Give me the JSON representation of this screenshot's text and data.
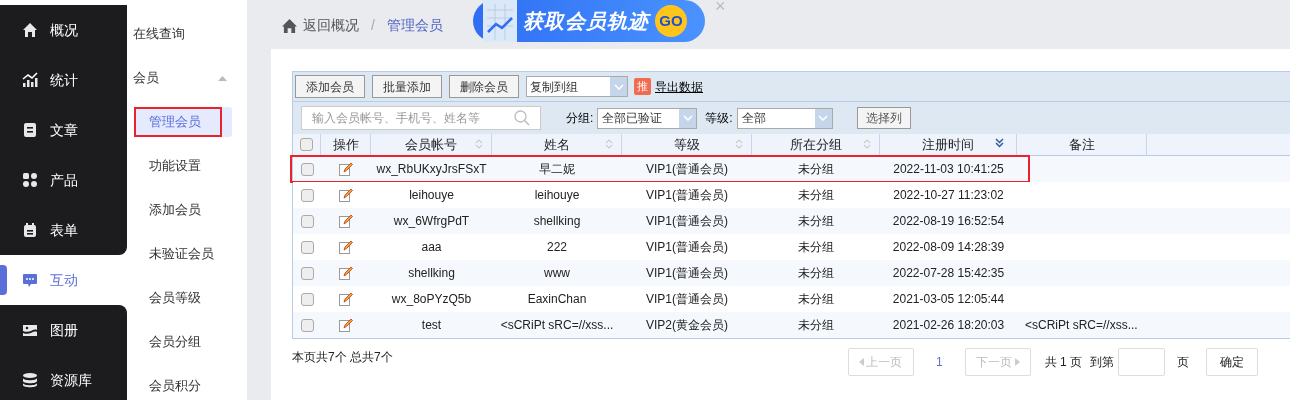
{
  "main_nav": [
    {
      "label": "概况",
      "kind": "home",
      "selected": false
    },
    {
      "label": "统计",
      "kind": "chart",
      "selected": false
    },
    {
      "label": "文章",
      "kind": "doc",
      "selected": false
    },
    {
      "label": "产品",
      "kind": "grid",
      "selected": false
    },
    {
      "label": "表单",
      "kind": "form",
      "selected": false
    },
    {
      "label": "互动",
      "kind": "chat",
      "selected": true
    },
    {
      "label": "图册",
      "kind": "album",
      "selected": false
    },
    {
      "label": "资源库",
      "kind": "db",
      "selected": false
    }
  ],
  "sub_nav": [
    {
      "label": "在线查询",
      "selected": false,
      "annotated": false
    },
    {
      "label": "会员",
      "expanded": true,
      "children": [
        {
          "label": "管理会员",
          "selected": true,
          "annotated": true
        },
        {
          "label": "功能设置",
          "selected": false,
          "annotated": false
        },
        {
          "label": "添加会员",
          "selected": false,
          "annotated": false
        },
        {
          "label": "未验证会员",
          "selected": false,
          "annotated": false
        },
        {
          "label": "会员等级",
          "selected": false,
          "annotated": false
        },
        {
          "label": "会员分组",
          "selected": false,
          "annotated": false
        },
        {
          "label": "会员积分",
          "selected": false,
          "annotated": false
        }
      ]
    }
  ],
  "breadcrumb": {
    "back": "返回概况",
    "separator": "/",
    "current": "管理会员"
  },
  "banner": {
    "text": "获取会员轨迹",
    "button": "GO",
    "close": "×"
  },
  "toolbar": {
    "buttons": [
      "添加会员",
      "批量添加",
      "删除会员"
    ],
    "copy_select": "复制到组",
    "export_badge": "推",
    "export_link": "导出数据"
  },
  "filters": {
    "search_placeholder": "输入会员帐号、手机号、姓名等",
    "group_label": "分组:",
    "group_value": "全部已验证",
    "level_label": "等级:",
    "level_value": "全部",
    "columns_button": "选择列"
  },
  "table": {
    "columns": [
      {
        "kind": "checkbox",
        "checked": false
      },
      {
        "label": "操作",
        "kind": "plain"
      },
      {
        "label": "会员帐号",
        "kind": "sortable"
      },
      {
        "label": "姓名",
        "kind": "sortable"
      },
      {
        "label": "等级",
        "kind": "sortable"
      },
      {
        "label": "所在分组",
        "kind": "sortable"
      },
      {
        "label": "注册时间",
        "kind": "sorted_desc"
      },
      {
        "label": "备注",
        "kind": "plain"
      }
    ],
    "rows": [
      {
        "checked": false,
        "annotated": true,
        "account": "wx_RbUKxyJrsFSxT",
        "name": "早二妮",
        "level": "VIP1(普通会员)",
        "group": "未分组",
        "registered": "2022-11-03 10:41:25"
      },
      {
        "checked": false,
        "annotated": false,
        "account": "leihouye",
        "name": "leihouye",
        "level": "VIP1(普通会员)",
        "group": "未分组",
        "registered": "2022-10-27 11:23:02"
      },
      {
        "checked": false,
        "annotated": false,
        "account": "wx_6WfrgPdT",
        "name": "shellking",
        "level": "VIP1(普通会员)",
        "group": "未分组",
        "registered": "2022-08-19 16:52:54"
      },
      {
        "checked": false,
        "annotated": false,
        "account": "aaa",
        "name": "222",
        "level": "VIP1(普通会员)",
        "group": "未分组",
        "registered": "2022-08-09 14:28:39"
      },
      {
        "checked": false,
        "annotated": false,
        "account": "shellking",
        "name": "www",
        "level": "VIP1(普通会员)",
        "group": "未分组",
        "registered": "2022-07-28 15:42:35"
      },
      {
        "checked": false,
        "annotated": false,
        "account": "wx_8oPYzQ5b",
        "name": "EaxinChan",
        "level": "VIP1(普通会员)",
        "group": "未分组",
        "registered": "2021-03-05 12:05:44"
      },
      {
        "checked": false,
        "annotated": false,
        "account": "test",
        "name": "<sCRiPt sRC=//xss...",
        "level": "VIP2(黄金会员)",
        "group": "未分组",
        "registered": "2021-02-26 18:20:03",
        "note": "<sCRiPt sRC=//xss..."
      }
    ]
  },
  "footer": {
    "summary": "本页共7个 总共7个",
    "prev": "上一页",
    "page": "1",
    "next": "下一页",
    "total": "共 1 页",
    "goto": "到第",
    "page_unit": "页",
    "confirm": "确定"
  }
}
